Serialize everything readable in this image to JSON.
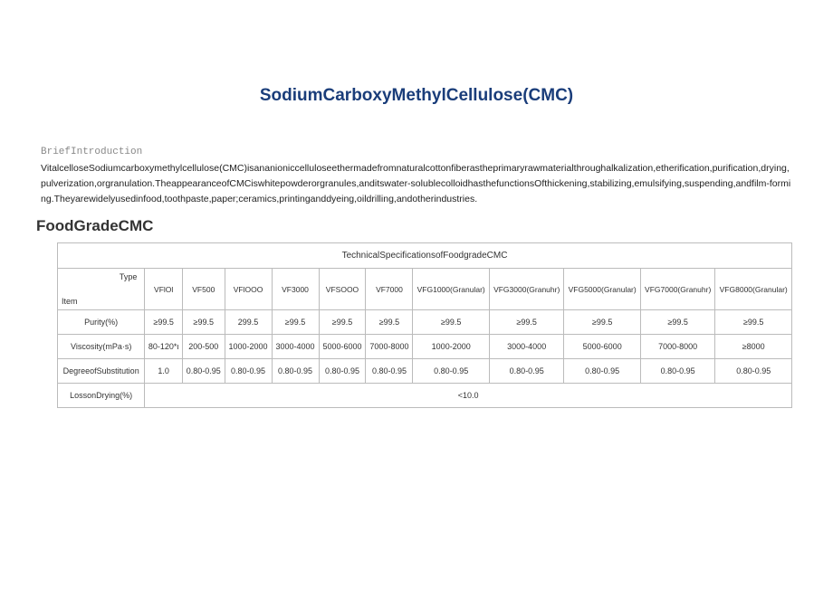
{
  "title": "SodiumCarboxyMethylCellulose(CMC)",
  "introLabel": "BriefIntroduction",
  "introText": "VitalcelloseSodiumcarboxymethylcellulose(CMC)isananioniccelluloseethermadefromnaturalcottonfiberastheprimaryrawmaterialthroughalkalization,etherification,purification,drying,pulverization,orgranulation.TheappearanceofCMCiswhitepowderorgranules,anditswater-solublecolloidhasthefunctionsOfthickening,stabilizing,emulsifying,suspending,andfilm-forming.Theyarewidelyusedinfood,toothpaste,paper;ceramics,printinganddyeing,oildrilling,andotherindustries.",
  "subheading": "FoodGradeCMC",
  "tableCaption": "TechnicalSpecificationsofFoodgradeCMC",
  "headerType": "Type",
  "headerItem": "Item",
  "chart_data": {
    "type": "table",
    "columns": [
      "VFlOl",
      "VF500",
      "VFlOOO",
      "VF3000",
      "VFSOOO",
      "VF7000",
      "VFG1000(Granular)",
      "VFG3000(Granuhr)",
      "VFG5000(Granular)",
      "VFG7000(Granuhr)",
      "VFG8000(Granular)"
    ],
    "rows": [
      {
        "label": "Purity(%)",
        "values": [
          "≥99.5",
          "≥99.5",
          "299.5",
          "≥99.5",
          "≥99.5",
          "≥99.5",
          "≥99.5",
          "≥99.5",
          "≥99.5",
          "≥99.5",
          "≥99.5"
        ]
      },
      {
        "label": "Viscosity(mPa·s)",
        "values": [
          "80-120*ι",
          "200-500",
          "1000-2000",
          "3000-4000",
          "5000-6000",
          "7000-8000",
          "1000-2000",
          "3000-4000",
          "5000-6000",
          "7000-8000",
          "≥8000"
        ]
      },
      {
        "label": "DegreeofSubstitution",
        "values": [
          "1.0",
          "0.80-0.95",
          "0.80-0.95",
          "0.80-0.95",
          "0.80-0.95",
          "0.80-0.95",
          "0.80-0.95",
          "0.80-0.95",
          "0.80-0.95",
          "0.80-0.95",
          "0.80-0.95"
        ]
      },
      {
        "label": "LossonDrying(%)",
        "merged": "<10.0"
      }
    ]
  }
}
